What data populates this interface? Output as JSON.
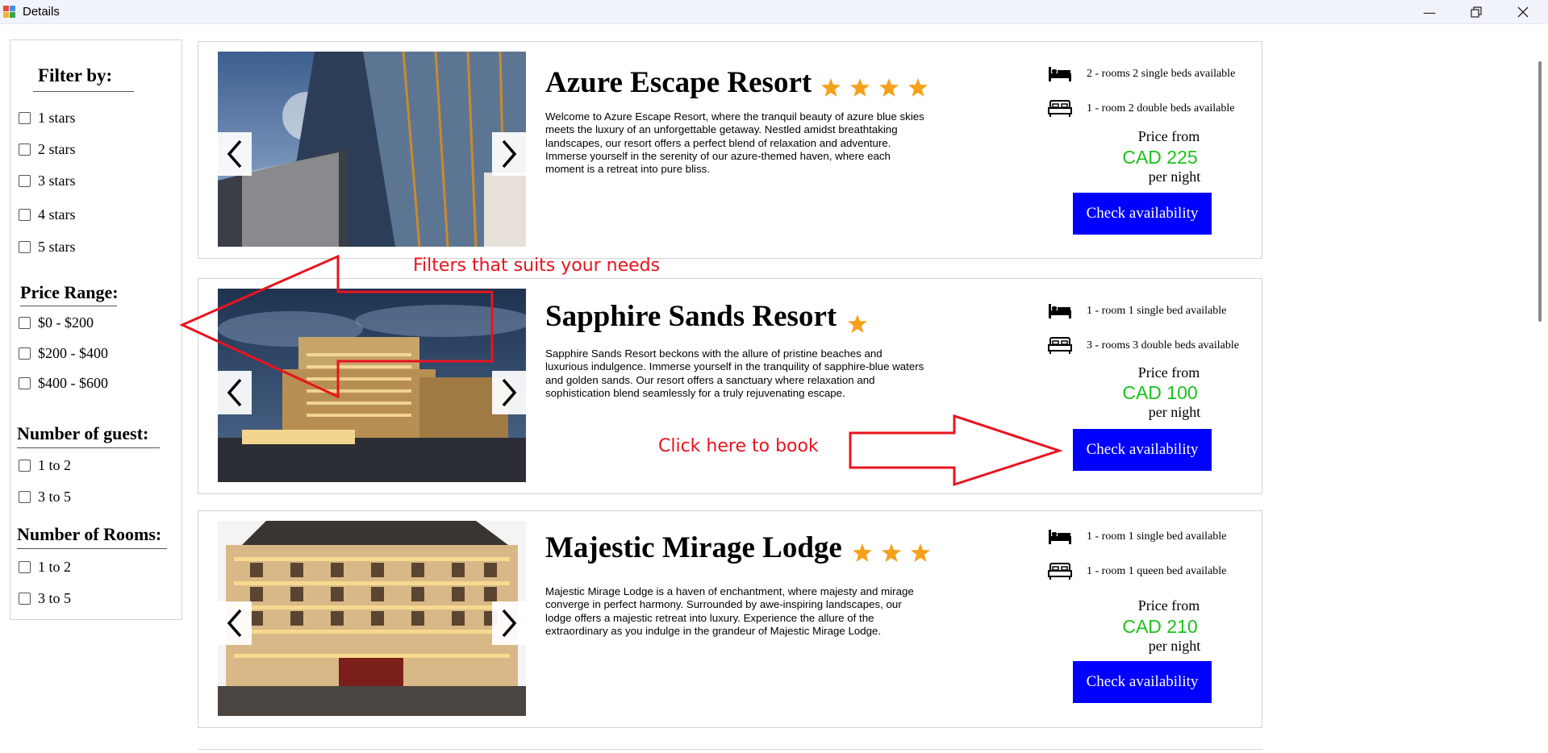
{
  "window": {
    "title": "Details",
    "minimize_icon": "minimize-icon",
    "maximize_icon": "restore-icon",
    "close_icon": "close-icon"
  },
  "filters": {
    "title": "Filter by:",
    "stars": [
      "1 stars",
      "2 stars",
      "3 stars",
      "4 stars",
      "5 stars"
    ],
    "price_range": {
      "title": "Price Range:",
      "options": [
        "$0 - $200",
        "$200 - $400",
        "$400 - $600"
      ]
    },
    "guests": {
      "title": "Number of guest:",
      "options": [
        "1 to 2",
        "3 to 5"
      ]
    },
    "rooms": {
      "title": "Number of Rooms:",
      "options": [
        "1 to 2",
        "3 to 5"
      ]
    }
  },
  "hotels": [
    {
      "name": "Azure Escape Resort",
      "stars": 4,
      "description": "Welcome to Azure Escape Resort, where the tranquil beauty of azure blue skies meets the luxury of an unforgettable getaway. Nestled amidst breathtaking landscapes, our resort offers a perfect blend of relaxation and adventure. Immerse yourself in the serenity of our azure-themed haven, where each moment is a retreat into pure bliss.",
      "rooms": [
        "2 - rooms 2 single beds available",
        "1 - room 2 double beds available"
      ],
      "price_from": "Price from",
      "price": "CAD 225",
      "per_night": "per night",
      "button": "Check availability"
    },
    {
      "name": "Sapphire Sands Resort",
      "stars": 1,
      "description": "Sapphire Sands Resort beckons with the allure of pristine beaches and luxurious indulgence. Immerse yourself in the tranquility of sapphire-blue waters and golden sands. Our resort offers a sanctuary where relaxation and sophistication blend seamlessly for a truly rejuvenating escape.",
      "rooms": [
        "1 - room 1 single bed available",
        "3 - rooms 3 double beds available"
      ],
      "price_from": "Price from",
      "price": "CAD 100",
      "per_night": "per night",
      "button": "Check availability"
    },
    {
      "name": "Majestic Mirage Lodge",
      "stars": 3,
      "description": "Majestic Mirage Lodge is a haven of enchantment, where majesty and mirage converge in perfect harmony. Surrounded by awe-inspiring landscapes, our lodge offers a majestic retreat into luxury. Experience the allure of the extraordinary as you indulge in the grandeur of Majestic Mirage Lodge.",
      "rooms": [
        "1 - room 1 single bed available",
        "1 - room 1 queen bed available"
      ],
      "price_from": "Price from",
      "price": "CAD 210",
      "per_night": "per night",
      "button": "Check availability"
    }
  ],
  "annotations": {
    "filters_note": "Filters that suits your needs",
    "book_note": "Click here to book"
  },
  "colors": {
    "button": "#0000ff",
    "price": "#19c319",
    "star": "#f5a11c",
    "annotation": "#e8141e"
  },
  "icons": {
    "single_bed": "single-bed-icon",
    "double_bed": "double-bed-icon",
    "star": "star-icon",
    "prev": "chevron-left-icon",
    "next": "chevron-right-icon"
  }
}
